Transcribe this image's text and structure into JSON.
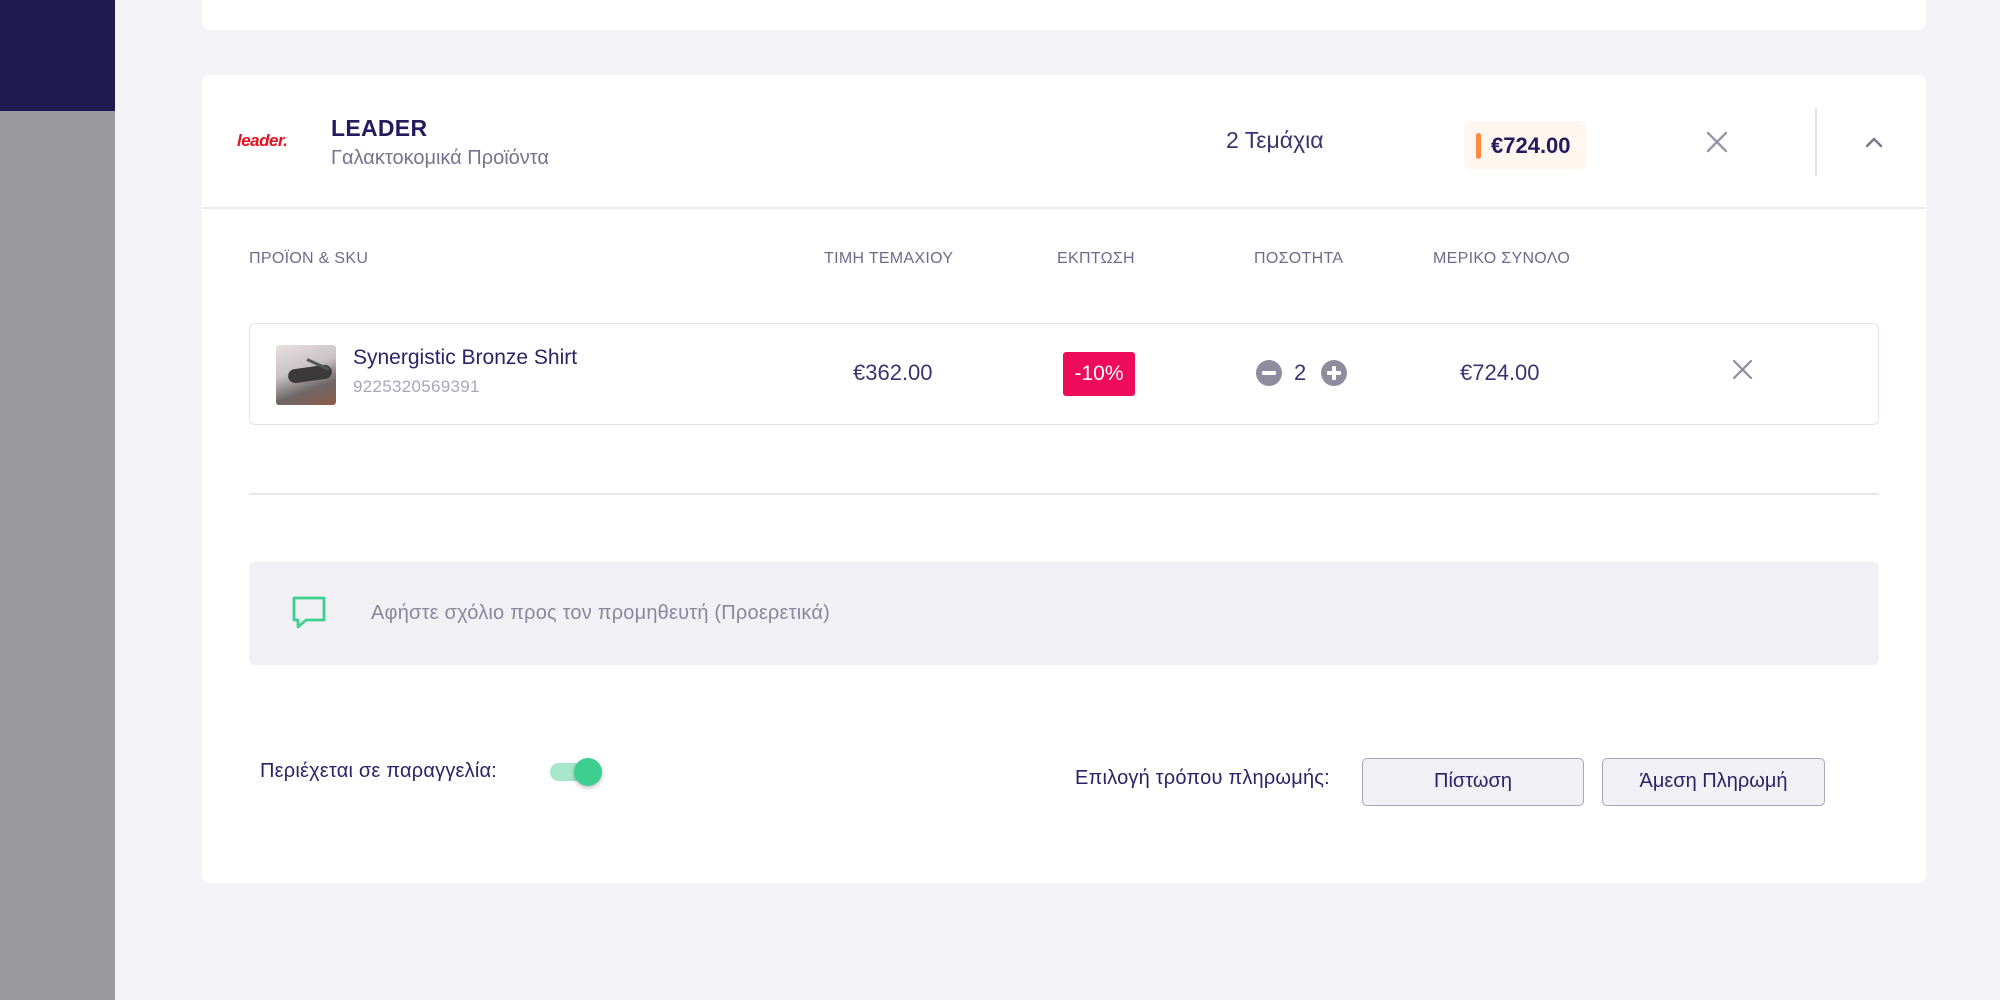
{
  "supplier": {
    "logo_text": "leader.",
    "name": "LEADER",
    "category": "Γαλακτοκομικά Προϊόντα",
    "pieces": "2 Τεμάχια",
    "total": "€724.00"
  },
  "columns": {
    "product": "ΠΡΟΪΟΝ & SKU",
    "unit_price": "ΤΙΜΗ ΤΕΜΑΧΙΟΥ",
    "discount": "ΕΚΠΤΩΣΗ",
    "quantity": "ΠΟΣΟΤΗΤΑ",
    "subtotal": "ΜΕΡΙΚΟ ΣΥΝΟΛΟ"
  },
  "items": [
    {
      "name": "Synergistic Bronze Shirt",
      "sku": "9225320569391",
      "unit_price": "€362.00",
      "discount": "-10%",
      "quantity": "2",
      "subtotal": "€724.00"
    }
  ],
  "comment": {
    "placeholder": "Αφήστε σχόλιο προς τον προμηθευτή (Προερετικά)"
  },
  "order": {
    "included_label": "Περιέχεται σε παραγγελία:",
    "included": true
  },
  "payment": {
    "label": "Επιλογή τρόπου πληρωμής:",
    "credit": "Πίστωση",
    "direct": "Άμεση Πληρωμή"
  },
  "colors": {
    "brand_dark": "#211a52",
    "discount": "#ed0b5a",
    "toggle_on": "#3ccf8f",
    "total_accent": "#ff8a3d"
  }
}
